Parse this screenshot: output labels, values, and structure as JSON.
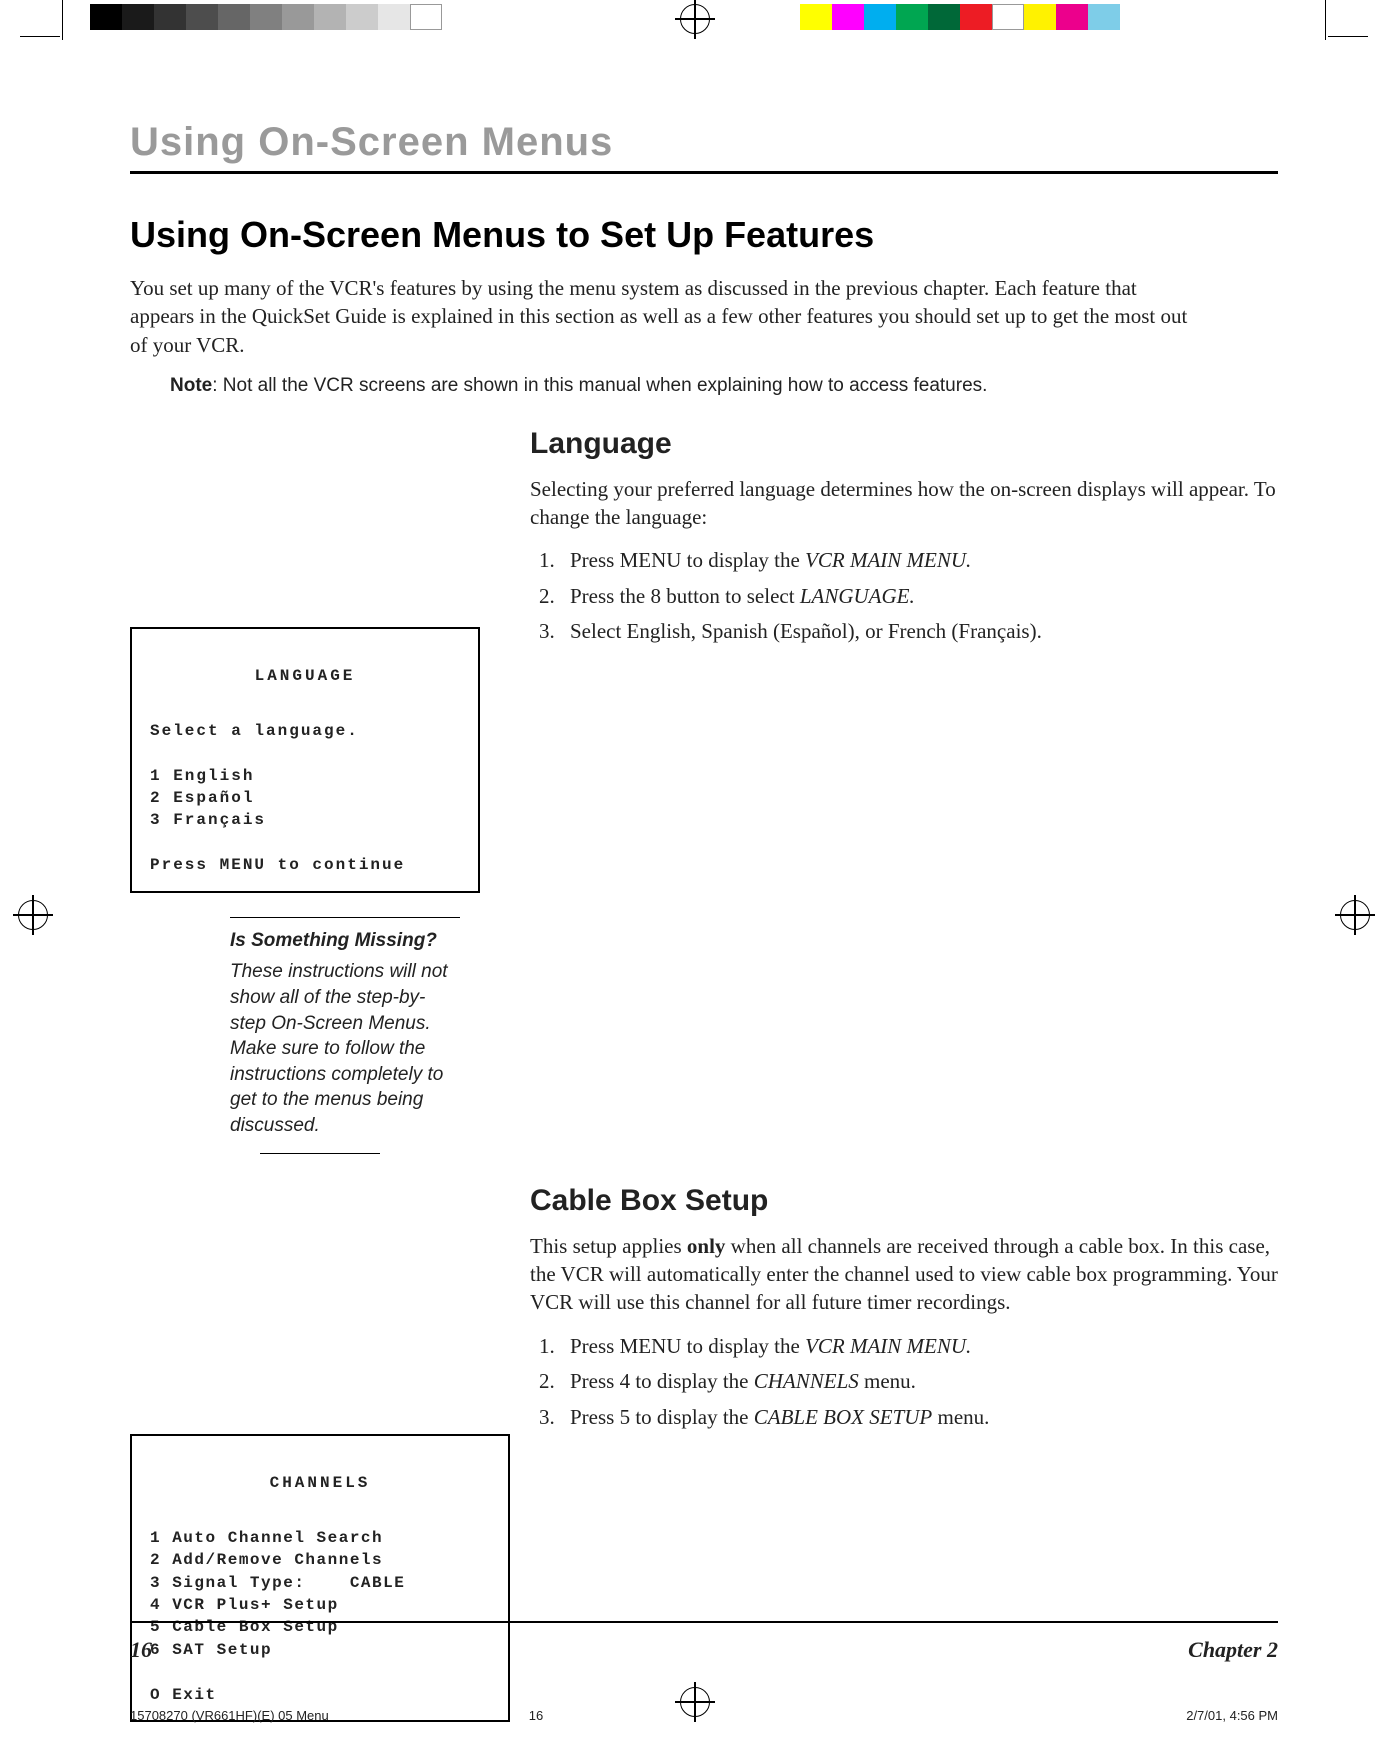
{
  "header": {
    "chapter_head": "Using On-Screen Menus"
  },
  "section": {
    "title": "Using On-Screen Menus to Set Up Features",
    "intro": "You set up many of the VCR's features by using the menu system as discussed in the previous chapter. Each feature that appears in the QuickSet Guide is explained in this section as well as a few other features you should set up to get the most out of your VCR.",
    "note_label": "Note",
    "note_text": ": Not all the VCR screens are shown in this manual when explaining how to access features."
  },
  "language": {
    "heading": "Language",
    "intro": "Selecting your preferred language determines how the on-screen displays will appear. To change the language:",
    "steps": {
      "s1a": "Press MENU to display the ",
      "s1b": "VCR MAIN MENU.",
      "s2a": "Press the 8 button to select ",
      "s2b": "LANGUAGE.",
      "s3": "Select English, Spanish (Español), or French (Français)."
    },
    "screen": {
      "title": "LANGUAGE",
      "line1": "Select a language.",
      "opt1": "1 English",
      "opt2": "2 Español",
      "opt3": "3 Français",
      "footer": "Press MENU to continue"
    }
  },
  "aside": {
    "title": "Is Something Missing?",
    "body": "These instructions will not show all of the step-by-step On-Screen Menus. Make sure to follow the instructions completely to get to the menus being discussed."
  },
  "cable": {
    "heading": "Cable Box Setup",
    "intro_a": "This setup applies ",
    "intro_bold": "only",
    "intro_b": " when all channels are received through a cable box. In this case, the VCR will automatically enter the channel used to view cable box programming. Your VCR will use this channel for all future timer recordings.",
    "steps": {
      "s1a": "Press MENU to display the ",
      "s1b": "VCR MAIN MENU.",
      "s2a": "Press 4 to display the ",
      "s2b": "CHANNELS",
      "s2c": " menu.",
      "s3a": "Press 5 to display the ",
      "s3b": "CABLE BOX SETUP",
      "s3c": " menu."
    },
    "screen": {
      "title": "CHANNELS",
      "l1": "1 Auto Channel Search",
      "l2": "2 Add/Remove Channels",
      "l3": "3 Signal Type:    CABLE",
      "l4": "4 VCR Plus+ Setup",
      "l5": "5 Cable Box Setup",
      "l6": "6 SAT Setup",
      "l7": "O Exit"
    }
  },
  "footer": {
    "page": "16",
    "chapter": "Chapter 2"
  },
  "slug": {
    "file": "15708270 (VR661HF)(E) 05 Menu",
    "page": "16",
    "datetime": "2/7/01, 4:56 PM"
  }
}
